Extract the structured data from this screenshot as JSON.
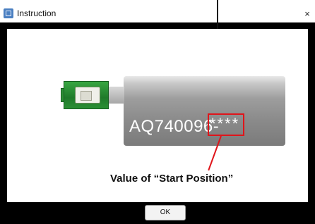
{
  "window": {
    "title": "Instruction",
    "close_symbol": "×",
    "icon": "app-icon"
  },
  "illustration": {
    "model_prefix": "AQ740096-",
    "model_suffix": "****",
    "callout_caption": "Value of “Start Position”"
  },
  "footer": {
    "ok_label": "OK"
  },
  "colors": {
    "highlight": "#e0141a",
    "connector": "#1f7a2a"
  }
}
